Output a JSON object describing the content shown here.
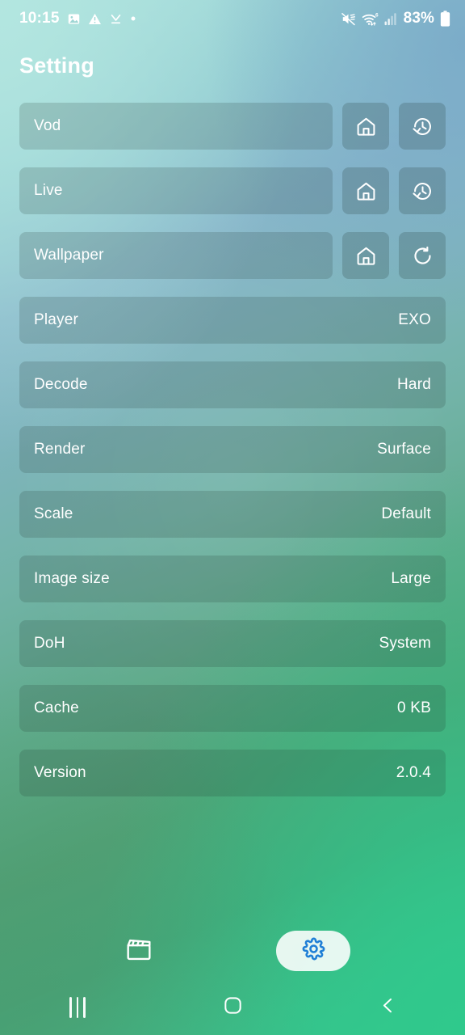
{
  "status_bar": {
    "time": "10:15",
    "battery_percent": "83%",
    "left_icons": [
      "photo-icon",
      "warning-triangle-icon",
      "download-complete-icon",
      "dot-icon"
    ],
    "right_icons": [
      "mute-icon",
      "wifi-6-icon",
      "signal-bars-icon",
      "battery-icon"
    ]
  },
  "header": {
    "title": "Setting"
  },
  "settings": {
    "rows": [
      {
        "label": "Vod",
        "value": "",
        "buttons": [
          "home-icon",
          "history-icon"
        ]
      },
      {
        "label": "Live",
        "value": "",
        "buttons": [
          "home-icon",
          "history-icon"
        ]
      },
      {
        "label": "Wallpaper",
        "value": "",
        "buttons": [
          "home-icon",
          "refresh-icon"
        ]
      },
      {
        "label": "Player",
        "value": "EXO",
        "buttons": []
      },
      {
        "label": "Decode",
        "value": "Hard",
        "buttons": []
      },
      {
        "label": "Render",
        "value": "Surface",
        "buttons": []
      },
      {
        "label": "Scale",
        "value": "Default",
        "buttons": []
      },
      {
        "label": "Image size",
        "value": "Large",
        "buttons": []
      },
      {
        "label": "DoH",
        "value": "System",
        "buttons": []
      },
      {
        "label": "Cache",
        "value": "0 KB",
        "buttons": []
      },
      {
        "label": "Version",
        "value": "2.0.4",
        "buttons": []
      }
    ]
  },
  "tab_bar": {
    "tabs": [
      {
        "name": "vod-tab",
        "icon": "clapperboard-icon",
        "active": false
      },
      {
        "name": "settings-tab",
        "icon": "gear-icon",
        "active": true
      }
    ]
  },
  "nav_bar": {
    "buttons": [
      "recents-icon",
      "home-icon",
      "back-icon"
    ]
  },
  "colors": {
    "accent": "#1f7fd6",
    "text": "#ffffff",
    "row_overlay": "rgba(30,48,44,0.17)",
    "gradient_top_left": "#a9e0dc",
    "gradient_top_right": "#86b2ca",
    "gradient_bottom_right": "#3cc68e",
    "gradient_bottom_left": "#4f9b6d"
  }
}
